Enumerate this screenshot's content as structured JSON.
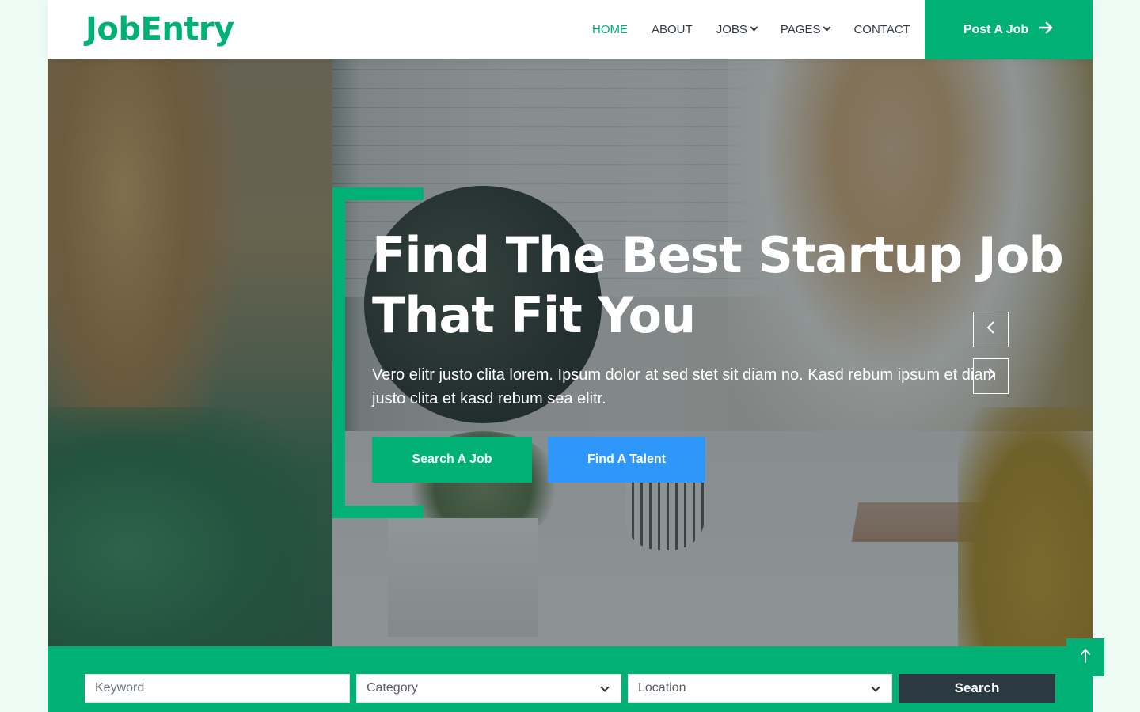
{
  "brand": "JobEntry",
  "nav": {
    "items": [
      {
        "label": "HOME",
        "active": true,
        "dropdown": false
      },
      {
        "label": "ABOUT",
        "active": false,
        "dropdown": false
      },
      {
        "label": "JOBS",
        "active": false,
        "dropdown": true
      },
      {
        "label": "PAGES",
        "active": false,
        "dropdown": true
      },
      {
        "label": "CONTACT",
        "active": false,
        "dropdown": false
      }
    ],
    "cta_label": "Post A Job",
    "cta_icon": "arrow-right-icon"
  },
  "hero": {
    "title": "Find The Best Startup Job That Fit You",
    "text": "Vero elitr justo clita lorem. Ipsum dolor at sed stet sit diam no. Kasd rebum ipsum et diam justo clita et kasd rebum sea elitr.",
    "primary_button": "Search A Job",
    "secondary_button": "Find A Talent",
    "prev_icon": "chevron-left-icon",
    "next_icon": "chevron-right-icon"
  },
  "search": {
    "keyword_placeholder": "Keyword",
    "category_value": "Category",
    "location_value": "Location",
    "button_label": "Search"
  },
  "back_to_top_icon": "arrow-up-icon",
  "colors": {
    "primary": "#00b074",
    "secondary": "#2f96fa",
    "dark": "#2b3940",
    "page_bg": "#eefaf4"
  }
}
